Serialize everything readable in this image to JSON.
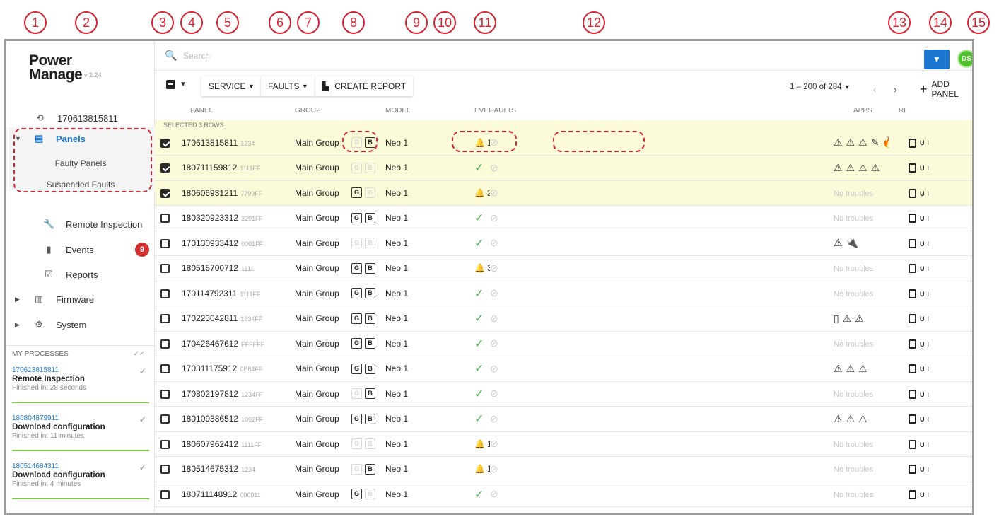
{
  "callouts": [
    "1",
    "2",
    "3",
    "4",
    "5",
    "6",
    "7",
    "8",
    "9",
    "10",
    "11",
    "12",
    "13",
    "14",
    "15"
  ],
  "app": {
    "logo_line1": "Power",
    "logo_line2": "Manage",
    "version": "v 2.24"
  },
  "sidebar": {
    "recent_panel": "170613815811",
    "items": [
      {
        "label": "Panels",
        "icon": "panels-icon"
      },
      {
        "label": "Faulty Panels"
      },
      {
        "label": "Suspended Faults"
      },
      {
        "label": "Remote Inspection",
        "icon": "wrench-icon"
      },
      {
        "label": "Events",
        "icon": "info-icon",
        "badge": "9"
      },
      {
        "label": "Reports",
        "icon": "reports-icon"
      },
      {
        "label": "Firmware",
        "icon": "firmware-icon"
      },
      {
        "label": "System",
        "icon": "gear-icon"
      }
    ],
    "processes_title": "MY PROCESSES",
    "processes": [
      {
        "id": "170613815811",
        "name": "Remote Inspection",
        "time": "Finished in: 28 seconds"
      },
      {
        "id": "180804879911",
        "name": "Download configuration",
        "time": "Finished in: 11 minutes"
      },
      {
        "id": "180514684311",
        "name": "Download configuration",
        "time": "Finished in: 4 minutes"
      }
    ]
  },
  "search": {
    "placeholder": "Search"
  },
  "user": {
    "initials": "DS"
  },
  "toolbar": {
    "service": "SERVICE",
    "faults": "FAULTS",
    "create_report": "CREATE REPORT",
    "pager": "1 – 200 of 284",
    "add_panel": "ADD PANEL"
  },
  "table": {
    "columns": [
      "PANEL",
      "GROUP",
      "MODEL",
      "EVENTS",
      "FAULTS",
      "APPS",
      "RI"
    ],
    "selected_info": "SELECTED 3 ROWS",
    "no_troubles": "No troubles",
    "rows": [
      {
        "serial": "170613815811",
        "code": "1234",
        "group": "Main Group",
        "g": false,
        "b": true,
        "model": "Neo 1",
        "alarms": "1",
        "warnings": "0",
        "faults": [
          "⚠",
          "⚠",
          "⚠",
          "✎",
          "🔥"
        ],
        "checked": true,
        "ri_error": true
      },
      {
        "serial": "180711159812",
        "code": "1111FF",
        "group": "Main Group",
        "g": false,
        "b": false,
        "model": "Neo 1",
        "alarms": "",
        "warnings": "",
        "faults": [
          "⚠",
          "⚠",
          "⚠",
          "⚠"
        ],
        "checked": true,
        "ri_error": false
      },
      {
        "serial": "180606931211",
        "code": "7799FF",
        "group": "Main Group",
        "g": true,
        "b": false,
        "model": "Neo 1",
        "alarms": "23",
        "warnings": "0",
        "faults": [],
        "checked": true,
        "ri_error": false
      },
      {
        "serial": "180320923312",
        "code": "3201FF",
        "group": "Main Group",
        "g": true,
        "b": true,
        "model": "Neo 1",
        "alarms": "",
        "warnings": "",
        "faults": [],
        "checked": false,
        "ri_error": false
      },
      {
        "serial": "170130933412",
        "code": "0001FF",
        "group": "Main Group",
        "g": false,
        "b": false,
        "model": "Neo 1",
        "alarms": "",
        "warnings": "",
        "faults": [
          "⚠",
          "🔌"
        ],
        "checked": false,
        "ri_error": false
      },
      {
        "serial": "180515700712",
        "code": "1111",
        "group": "Main Group",
        "g": true,
        "b": true,
        "model": "Neo 1",
        "alarms": "32",
        "warnings": "0",
        "faults": [],
        "checked": false,
        "ri_error": false
      },
      {
        "serial": "170114792311",
        "code": "1111FF",
        "group": "Main Group",
        "g": true,
        "b": true,
        "model": "Neo 1",
        "alarms": "",
        "warnings": "",
        "faults": [],
        "checked": false,
        "ri_error": false
      },
      {
        "serial": "170223042811",
        "code": "1234FF",
        "group": "Main Group",
        "g": true,
        "b": true,
        "model": "Neo 1",
        "alarms": "",
        "warnings": "",
        "faults": [
          "▯",
          "⚠",
          "⚠"
        ],
        "checked": false,
        "ri_error": false
      },
      {
        "serial": "170426467612",
        "code": "FFFFFF",
        "group": "Main Group",
        "g": true,
        "b": true,
        "model": "Neo 1",
        "alarms": "",
        "warnings": "",
        "faults": [],
        "checked": false,
        "ri_error": false
      },
      {
        "serial": "170311175912",
        "code": "0E84FF",
        "group": "Main Group",
        "g": true,
        "b": true,
        "model": "Neo 1",
        "alarms": "",
        "warnings": "",
        "faults": [
          "⚠",
          "⚠",
          "⚠"
        ],
        "checked": false,
        "ri_error": false
      },
      {
        "serial": "170802197812",
        "code": "1234FF",
        "group": "Main Group",
        "g": false,
        "b": true,
        "model": "Neo 1",
        "alarms": "",
        "warnings": "",
        "faults": [],
        "checked": false,
        "ri_error": false
      },
      {
        "serial": "180109386512",
        "code": "1002FF",
        "group": "Main Group",
        "g": true,
        "b": true,
        "model": "Neo 1",
        "alarms": "",
        "warnings": "",
        "faults": [
          "⚠",
          "⚠",
          "⚠"
        ],
        "checked": false,
        "ri_error": false
      },
      {
        "serial": "180607962412",
        "code": "1111FF",
        "group": "Main Group",
        "g": false,
        "b": false,
        "model": "Neo 1",
        "alarms": "14",
        "warnings": "0",
        "faults": [],
        "checked": false,
        "ri_error": false
      },
      {
        "serial": "180514675312",
        "code": "1234",
        "group": "Main Group",
        "g": false,
        "b": true,
        "model": "Neo 1",
        "alarms": "18",
        "warnings": "0",
        "faults": [],
        "checked": false,
        "ri_error": false
      },
      {
        "serial": "180711148912",
        "code": "000011",
        "group": "Main Group",
        "g": true,
        "b": false,
        "model": "Neo 1",
        "alarms": "",
        "warnings": "",
        "faults": [],
        "checked": false,
        "ri_error": false
      }
    ]
  },
  "apps": {
    "u": "U",
    "i": "I"
  },
  "colors": {
    "accent": "#1976d2",
    "callout": "#d42433",
    "selected_row": "#fcfbd9",
    "ok": "#4caf50",
    "alarm": "#d32f2f"
  }
}
